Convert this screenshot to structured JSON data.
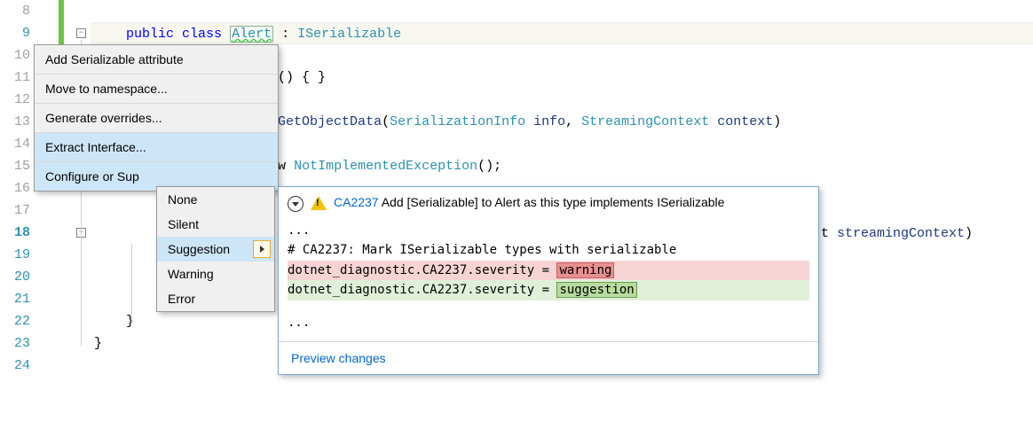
{
  "gutter": {
    "lines": [
      "8",
      "9",
      "10",
      "11",
      "12",
      "13",
      "14",
      "15",
      "16",
      "17",
      "18",
      "19",
      "20",
      "21",
      "22",
      "23",
      "24"
    ]
  },
  "code": {
    "l9": {
      "public": "public",
      "class": "class",
      "name": "Alert",
      "colon": " : ",
      "iface": "ISerializable"
    },
    "l11": "() { }",
    "l13": {
      "method": "GetObjectData",
      "p1type": "SerializationInfo",
      "p1name": "info",
      "p2type": "StreamingContext",
      "p2name": "context"
    },
    "l15": {
      "w": "w ",
      "type": "NotImplementedException",
      "tail": "();"
    },
    "l22_brace": "}",
    "l23_brace": "}",
    "peek": {
      "t": "t ",
      "name": "streamingContext",
      "tail": ")"
    }
  },
  "menu1": {
    "items": [
      "Add Serializable attribute",
      "Move to namespace...",
      "Generate overrides...",
      "Extract Interface...",
      "Configure or Sup"
    ]
  },
  "menu2": {
    "items": [
      "None",
      "Silent",
      "Suggestion",
      "Warning",
      "Error"
    ],
    "selected_index": 2
  },
  "panel": {
    "rule_id": "CA2237",
    "header_rest": " Add [Serializable] to Alert as this type implements ISerializable",
    "diff": {
      "ell1": "...",
      "comment": "# CA2237: Mark ISerializable types with serializable",
      "del_prefix": "dotnet_diagnostic.CA2237.severity = ",
      "del_val": "warning",
      "add_prefix": "dotnet_diagnostic.CA2237.severity = ",
      "add_val": "suggestion",
      "ell2": "..."
    },
    "footer": "Preview changes"
  }
}
